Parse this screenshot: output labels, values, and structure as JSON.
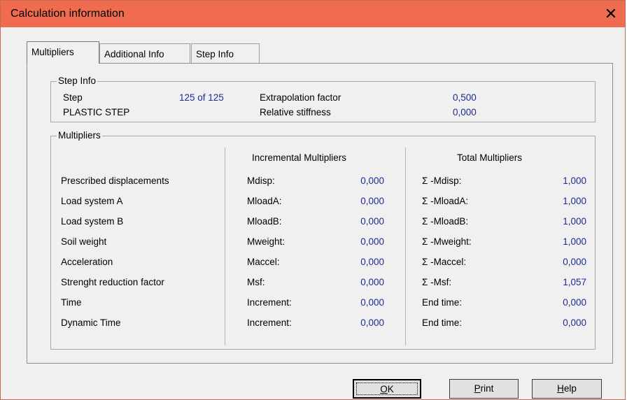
{
  "window": {
    "title": "Calculation information",
    "close_glyph": "✕"
  },
  "tabs": [
    {
      "label": "Multipliers",
      "active": true
    },
    {
      "label": "Additional Info",
      "active": false
    },
    {
      "label": "Step Info",
      "active": false
    }
  ],
  "step_info": {
    "legend": "Step Info",
    "step_label": "Step",
    "step_value": "125 of 125",
    "step_type": "PLASTIC STEP",
    "extrapolation_label": "Extrapolation factor",
    "extrapolation_value": "0,500",
    "stiffness_label": "Relative stiffness",
    "stiffness_value": "0,000"
  },
  "multipliers": {
    "legend": "Multipliers",
    "incremental_header": "Incremental Multipliers",
    "total_header": "Total Multipliers",
    "rows": [
      {
        "name": "Prescribed displacements",
        "inc_label": "Mdisp:",
        "inc_value": "0,000",
        "tot_label": "Σ -Mdisp:",
        "tot_value": "1,000"
      },
      {
        "name": "Load system A",
        "inc_label": "MloadA:",
        "inc_value": "0,000",
        "tot_label": "Σ -MloadA:",
        "tot_value": "1,000"
      },
      {
        "name": "Load system B",
        "inc_label": "MloadB:",
        "inc_value": "0,000",
        "tot_label": "Σ -MloadB:",
        "tot_value": "1,000"
      },
      {
        "name": "Soil weight",
        "inc_label": "Mweight:",
        "inc_value": "0,000",
        "tot_label": "Σ -Mweight:",
        "tot_value": "1,000"
      },
      {
        "name": "Acceleration",
        "inc_label": "Maccel:",
        "inc_value": "0,000",
        "tot_label": "Σ -Maccel:",
        "tot_value": "0,000"
      },
      {
        "name": "Strenght reduction factor",
        "inc_label": "Msf:",
        "inc_value": "0,000",
        "tot_label": "Σ -Msf:",
        "tot_value": "1,057"
      },
      {
        "name": "Time",
        "inc_label": "Increment:",
        "inc_value": "0,000",
        "tot_label": "End time:",
        "tot_value": "0,000"
      },
      {
        "name": "Dynamic Time",
        "inc_label": "Increment:",
        "inc_value": "0,000",
        "tot_label": "End time:",
        "tot_value": "0,000"
      }
    ]
  },
  "buttons": {
    "ok_accel": "O",
    "ok_rest": "K",
    "print_accel": "P",
    "print_rest": "rint",
    "help_accel": "H",
    "help_rest": "elp"
  },
  "colors": {
    "titlebar": "#ef6c50",
    "value_blue": "#1c2a93",
    "dialog_bg": "#f0f0f0"
  }
}
